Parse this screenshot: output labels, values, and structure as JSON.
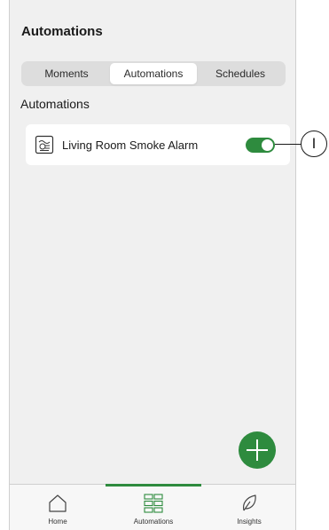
{
  "header": {
    "title": "Automations"
  },
  "tabs": [
    {
      "label": "Moments",
      "active": false
    },
    {
      "label": "Automations",
      "active": true
    },
    {
      "label": "Schedules",
      "active": false
    }
  ],
  "section": {
    "title": "Automations"
  },
  "automations": [
    {
      "label": "Living Room Smoke Alarm",
      "icon": "smoke-alarm-icon",
      "enabled": true
    }
  ],
  "callout": {
    "label": "I"
  },
  "fab": {
    "icon": "plus-icon"
  },
  "bottom_nav": [
    {
      "label": "Home",
      "icon": "home-icon",
      "active": false
    },
    {
      "label": "Automations",
      "icon": "grid-icon",
      "active": true
    },
    {
      "label": "Insights",
      "icon": "leaf-icon",
      "active": false
    }
  ],
  "colors": {
    "accent": "#2e8b3e",
    "background": "#f0f0f0",
    "card": "#ffffff"
  }
}
